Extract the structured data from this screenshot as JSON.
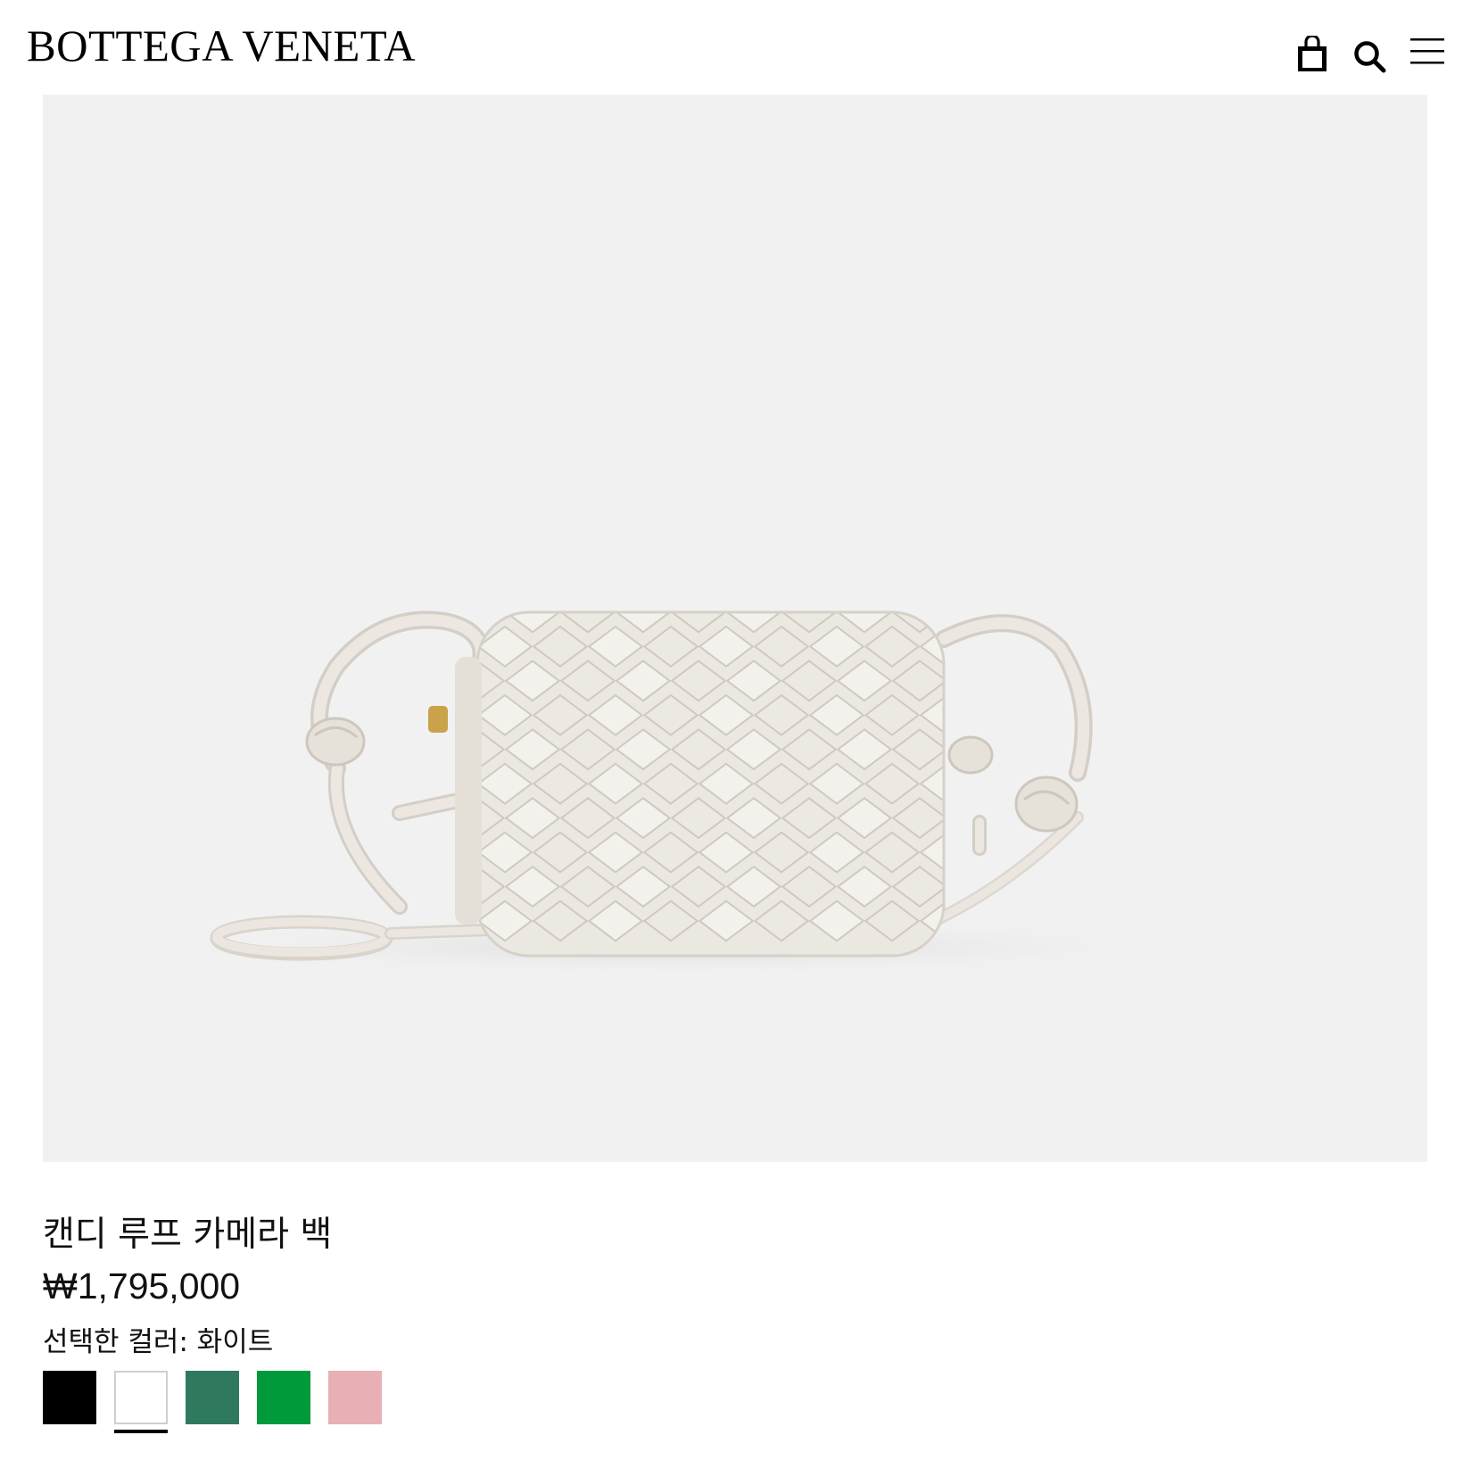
{
  "header": {
    "logo": "BOTTEGA VENETA",
    "icons": [
      "shopping-bag-icon",
      "search-icon",
      "menu-icon"
    ]
  },
  "product": {
    "name": "캔디 루프 카메라 백",
    "price": "₩1,795,000",
    "selected_color_label": "선택한 컬러:",
    "selected_color_value": "화이트",
    "image_background": "#f1f1f1",
    "swatches": [
      {
        "color": "#000000",
        "selected": false
      },
      {
        "color": "#ffffff",
        "selected": true
      },
      {
        "color": "#2f7a5e",
        "selected": false
      },
      {
        "color": "#009a3a",
        "selected": false
      },
      {
        "color": "#e8b0b4",
        "selected": false
      }
    ]
  }
}
